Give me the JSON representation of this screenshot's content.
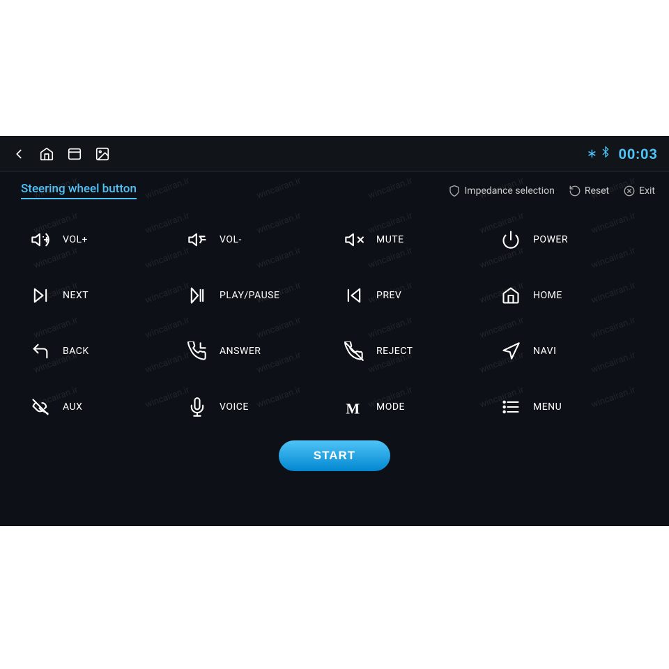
{
  "topbar": {
    "timer": "00:03",
    "icons": [
      "back-arrow",
      "home",
      "window",
      "image"
    ]
  },
  "page": {
    "title": "Steering wheel button",
    "actions": [
      {
        "icon": "shield",
        "label": "Impedance selection"
      },
      {
        "icon": "reset",
        "label": "Reset"
      },
      {
        "icon": "exit",
        "label": "Exit"
      }
    ]
  },
  "buttons": [
    {
      "icon": "vol-plus",
      "label": "VOL+"
    },
    {
      "icon": "vol-minus",
      "label": "VOL-"
    },
    {
      "icon": "mute",
      "label": "MUTE"
    },
    {
      "icon": "power",
      "label": "POWER"
    },
    {
      "icon": "next",
      "label": "NEXT"
    },
    {
      "icon": "play-pause",
      "label": "PLAY/PAUSE"
    },
    {
      "icon": "prev",
      "label": "PREV"
    },
    {
      "icon": "home",
      "label": "HOME"
    },
    {
      "icon": "back",
      "label": "BACK"
    },
    {
      "icon": "answer",
      "label": "ANSWER"
    },
    {
      "icon": "reject",
      "label": "REJECT"
    },
    {
      "icon": "navi",
      "label": "NAVI"
    },
    {
      "icon": "aux",
      "label": "AUX"
    },
    {
      "icon": "voice",
      "label": "VOICE"
    },
    {
      "icon": "mode",
      "label": "MODE"
    },
    {
      "icon": "menu",
      "label": "MENU"
    }
  ],
  "start_label": "START",
  "watermark_text": "wincairan.ir"
}
